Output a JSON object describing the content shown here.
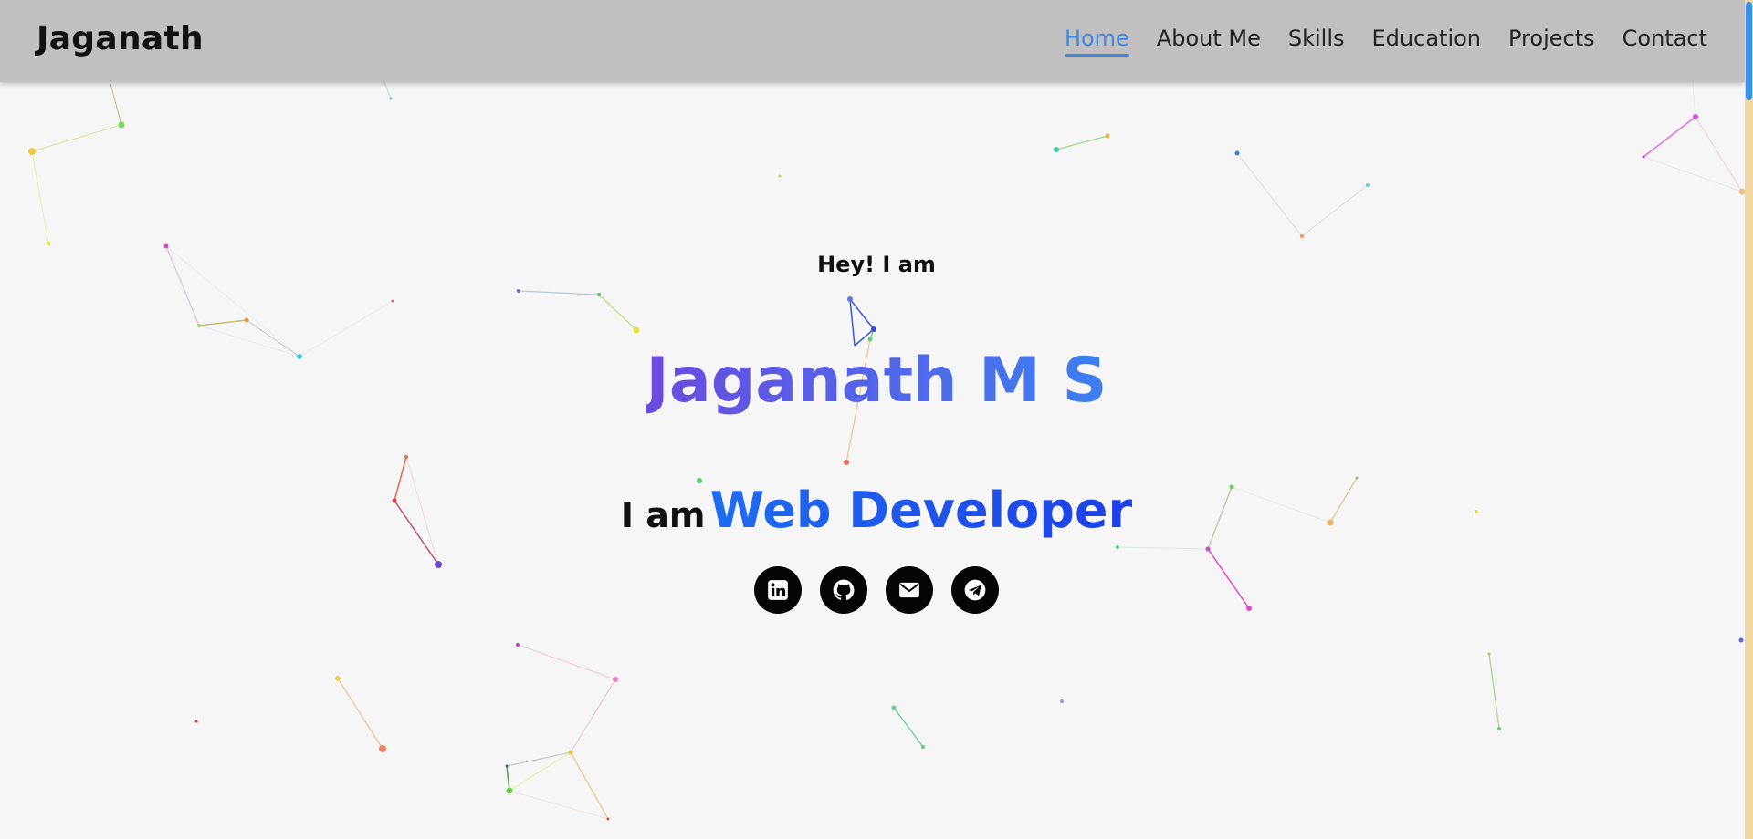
{
  "brand": "Jaganath",
  "nav": {
    "items": [
      {
        "label": "Home",
        "active": true
      },
      {
        "label": "About Me",
        "active": false
      },
      {
        "label": "Skills",
        "active": false
      },
      {
        "label": "Education",
        "active": false
      },
      {
        "label": "Projects",
        "active": false
      },
      {
        "label": "Contact",
        "active": false
      }
    ]
  },
  "hero": {
    "greeting": "Hey! I am",
    "name": "Jaganath M S",
    "role_prefix": "I am",
    "role": "Web Developer"
  },
  "socials": [
    {
      "icon": "linkedin-icon"
    },
    {
      "icon": "github-icon"
    },
    {
      "icon": "email-icon"
    },
    {
      "icon": "telegram-icon"
    }
  ],
  "colors": {
    "navbar_bg": "#c2bfc0",
    "accent": "#3d88e0",
    "page_bg": "#f6f6f6",
    "name_gradient_start": "#6a4be0",
    "name_gradient_end": "#3c7ff0",
    "role_color": "#1d4fe8",
    "social_bg": "#050505"
  }
}
